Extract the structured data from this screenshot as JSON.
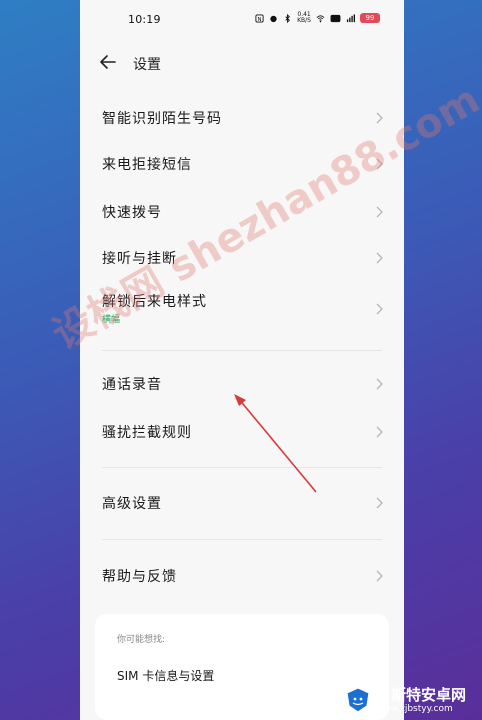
{
  "status_bar": {
    "time": "10:19",
    "speed_value": "0.41",
    "speed_unit": "KB/S",
    "battery": "99"
  },
  "header": {
    "title": "设置"
  },
  "menu_items": [
    {
      "label": "智能识别陌生号码"
    },
    {
      "label": "来电拒接短信"
    },
    {
      "label": "快速拨号"
    },
    {
      "label": "接听与挂断"
    },
    {
      "label": "解锁后来电样式",
      "sub": "横幅"
    },
    {
      "label": "通话录音"
    },
    {
      "label": "骚扰拦截规则"
    },
    {
      "label": "高级设置"
    },
    {
      "label": "帮助与反馈"
    }
  ],
  "suggestion_card": {
    "hint": "你可能想找:",
    "item": "SIM 卡信息与设置"
  },
  "watermark": {
    "text": "设栈网 shezhan88.com"
  },
  "logo": {
    "name": "贝斯特安卓网",
    "url": "www.zjbstyy.com"
  },
  "colors": {
    "accent_green": "#2aa55a",
    "battery": "#e04a5a",
    "arrow": "#d83a3a"
  }
}
